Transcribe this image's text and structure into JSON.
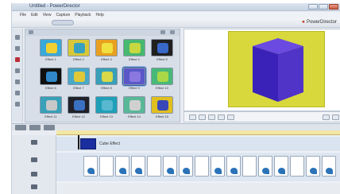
{
  "window": {
    "title": "Untitled - PowerDirector"
  },
  "menu": {
    "items": [
      "File",
      "Edit",
      "View",
      "Capture",
      "Playback",
      "Help"
    ]
  },
  "brand": {
    "name": "PowerDirector"
  },
  "library": {
    "tiles": [
      {
        "label": "Effect 1",
        "bg": "#3aa8d8",
        "glyph": "#f0d030"
      },
      {
        "label": "Effect 2",
        "bg": "#d8c838",
        "glyph": "#38a0c0"
      },
      {
        "label": "Effect 3",
        "bg": "#e8a020",
        "glyph": "#f0e040"
      },
      {
        "label": "Effect 4",
        "bg": "#48b870",
        "glyph": "#c8d840"
      },
      {
        "label": "Effect 5",
        "bg": "#202020",
        "glyph": "#3868c8"
      },
      {
        "label": "Effect 6",
        "bg": "#101010",
        "glyph": "#3088c8"
      },
      {
        "label": "Effect 7",
        "bg": "#48a8c8",
        "glyph": "#e0c838"
      },
      {
        "label": "Effect 8",
        "bg": "#38a0b8",
        "glyph": "#d8d848"
      },
      {
        "label": "Effect 9",
        "bg": "#5a58c8",
        "glyph": "#8a78e0"
      },
      {
        "label": "Effect 10",
        "bg": "#48b878",
        "glyph": "#a8d848"
      },
      {
        "label": "Effect 11",
        "bg": "#38a0b8",
        "glyph": "#c8c8c8"
      },
      {
        "label": "Effect 12",
        "bg": "#202028",
        "glyph": "#3a70c0"
      },
      {
        "label": "Effect 13",
        "bg": "#20a0b8",
        "glyph": "#58b8d0"
      },
      {
        "label": "Effect 14",
        "bg": "#58b898",
        "glyph": "#d0d0d0"
      },
      {
        "label": "Effect 15",
        "bg": "#e0c020",
        "glyph": "#3848b8"
      }
    ],
    "selected_index": 8
  },
  "timeline": {
    "clip_label": "Cube Effect",
    "transition_count": 16
  },
  "colors": {
    "preview_bg": "#d8d83c",
    "cube_front": "#3a22b8",
    "cube_top": "#6a4ae0",
    "clip": "#1b2ea0",
    "transition_icon": "#2b73b8"
  }
}
